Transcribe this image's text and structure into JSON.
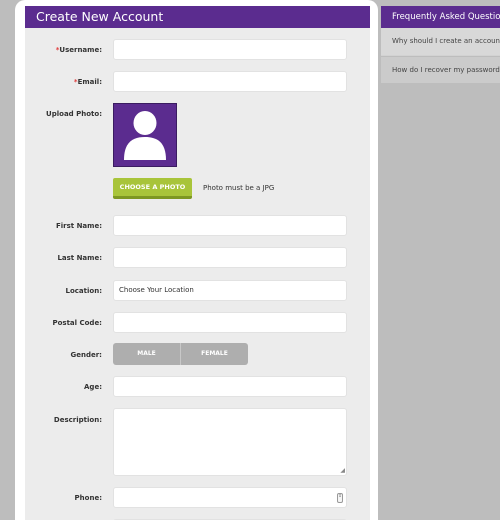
{
  "form": {
    "title": "Create New Account",
    "username_label": "Username:",
    "email_label": "Email:",
    "required_mark": "*",
    "upload_photo_label": "Upload Photo:",
    "choose_photo_button": "CHOOSE A PHOTO",
    "photo_note": "Photo must be a JPG",
    "first_name_label": "First Name:",
    "last_name_label": "Last Name:",
    "location_label": "Location:",
    "location_value": "Choose Your Location",
    "postal_code_label": "Postal Code:",
    "gender_label": "Gender:",
    "gender_options": [
      "MALE",
      "FEMALE"
    ],
    "age_label": "Age:",
    "description_label": "Description:",
    "phone_label": "Phone:"
  },
  "faq": {
    "title": "Frequently Asked Questions",
    "items": [
      "Why should I create an account?",
      "How do I recover my password?"
    ]
  },
  "colors": {
    "accent": "#5b2c8f",
    "button": "#a8c43a",
    "required": "#e03b3b"
  }
}
